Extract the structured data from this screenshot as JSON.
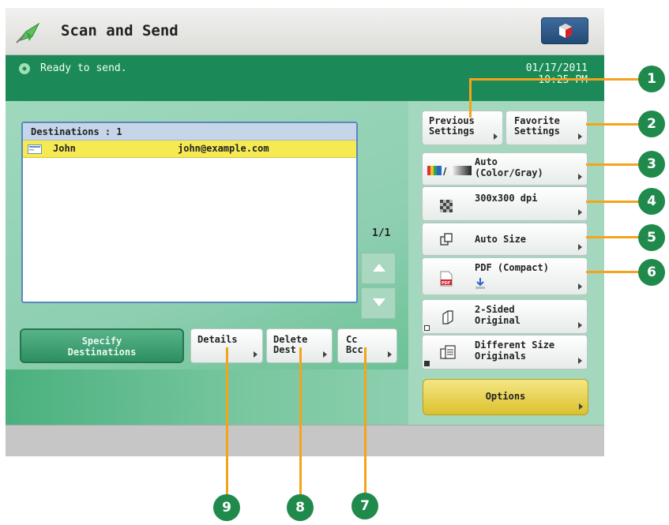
{
  "header": {
    "title": "Scan and Send"
  },
  "status": {
    "message": "Ready to send.",
    "date": "01/17/2011",
    "time": "10:25 PM"
  },
  "destinations": {
    "header": "Destinations  : 1",
    "items": [
      {
        "name": "John",
        "email": "john@example.com"
      }
    ],
    "page_indicator": "1/1"
  },
  "buttons": {
    "specify_line1": "Specify",
    "specify_line2": "Destinations",
    "details": "Details",
    "delete_line1": "Delete",
    "delete_line2": "Dest",
    "cc_line1": "Cc",
    "cc_line2": "Bcc"
  },
  "settings": {
    "previous_line1": "Previous",
    "previous_line2": "Settings",
    "favorite_line1": "Favorite",
    "favorite_line2": "Settings",
    "color_line1": "Auto",
    "color_line2": "(Color/Gray)",
    "resolution": "300x300 dpi",
    "size": "Auto Size",
    "format": "PDF (Compact)",
    "sided_line1": "2-Sided",
    "sided_line2": "Original",
    "diffsize_line1": "Different Size",
    "diffsize_line2": "Originals",
    "options": "Options"
  },
  "callouts": [
    "1",
    "2",
    "3",
    "4",
    "5",
    "6",
    "7",
    "8",
    "9"
  ],
  "colors": {
    "status_bar": "#1c8a58",
    "selected_row": "#f6ea53",
    "callout_line": "#f5a31b",
    "callout_circle": "#1f8a4c",
    "options_button": "#e8d23a"
  }
}
